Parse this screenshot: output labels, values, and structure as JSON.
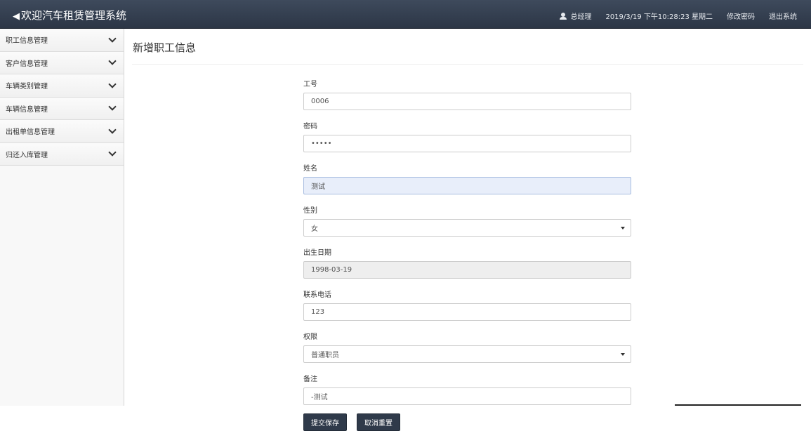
{
  "header": {
    "title": "欢迎汽车租赁管理系统",
    "user": "总经理",
    "datetime": "2019/3/19 下午10:28:23 星期二",
    "change_password": "修改密码",
    "logout": "退出系统"
  },
  "sidebar": {
    "items": [
      {
        "label": "职工信息管理"
      },
      {
        "label": "客户信息管理"
      },
      {
        "label": "车辆类别管理"
      },
      {
        "label": "车辆信息管理"
      },
      {
        "label": "出租单信息管理"
      },
      {
        "label": "归还入库管理"
      }
    ]
  },
  "main": {
    "title": "新增职工信息",
    "fields": {
      "employee_id": {
        "label": "工号",
        "value": "0006"
      },
      "password": {
        "label": "密码",
        "value": "•••••"
      },
      "name": {
        "label": "姓名",
        "value": "测试"
      },
      "gender": {
        "label": "性别",
        "value": "女"
      },
      "birthdate": {
        "label": "出生日期",
        "value": "1998-03-19"
      },
      "phone": {
        "label": "联系电话",
        "value": "123"
      },
      "permission": {
        "label": "权限",
        "value": "普通职员"
      },
      "remark": {
        "label": "备注",
        "value": "-测试"
      }
    },
    "buttons": {
      "submit": "提交保存",
      "reset": "取消重置"
    }
  }
}
